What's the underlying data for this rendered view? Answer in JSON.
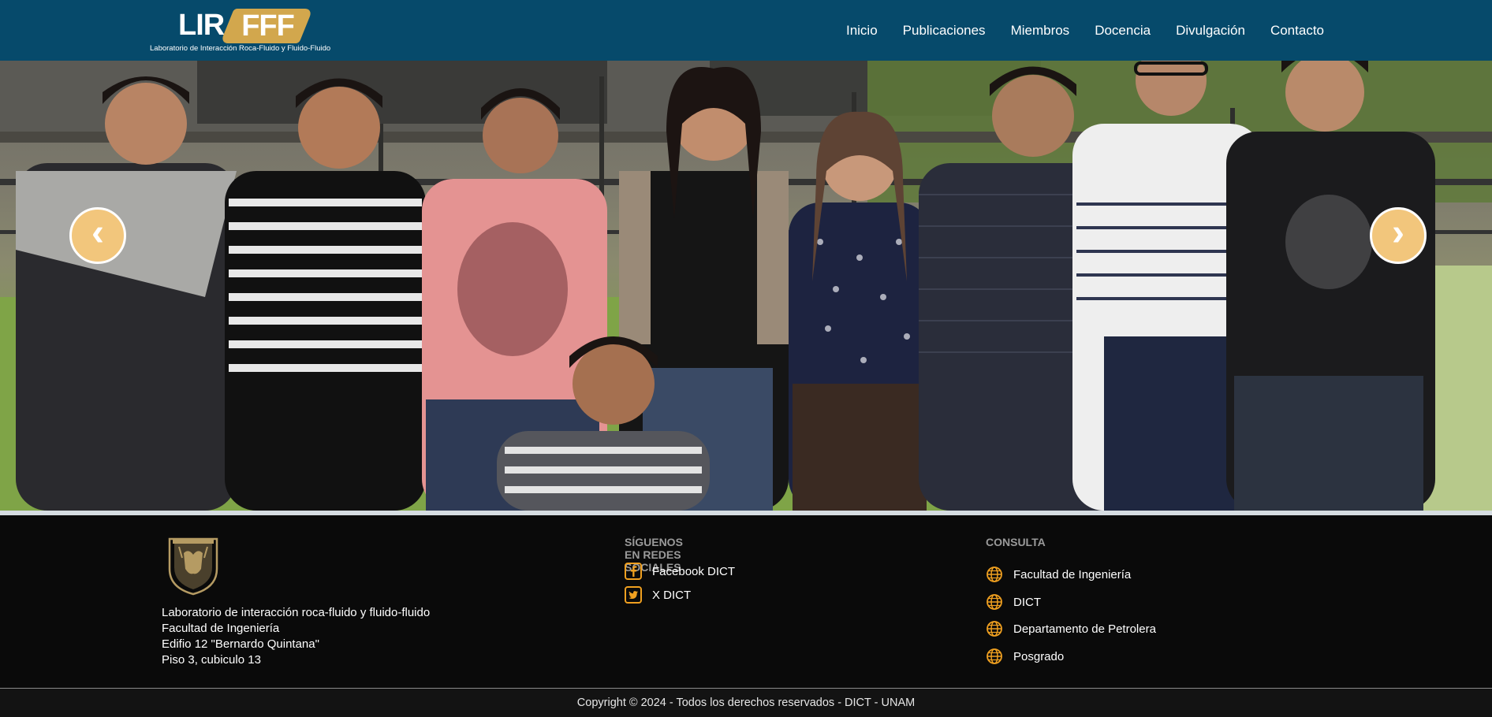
{
  "header": {
    "logo": {
      "part1": "LIR",
      "part2": "FFF",
      "subtitle": "Laboratorio de Interacción Roca-Fluido y Fluido-Fluido"
    },
    "nav": [
      {
        "label": "Inicio"
      },
      {
        "label": "Publicaciones"
      },
      {
        "label": "Miembros"
      },
      {
        "label": "Docencia"
      },
      {
        "label": "Divulgación"
      },
      {
        "label": "Contacto"
      }
    ],
    "bg_color": "#064a6b"
  },
  "hero": {
    "prev_glyph": "‹",
    "next_glyph": "›",
    "arrow_color": "#f2c67c"
  },
  "footer": {
    "address": [
      "Laboratorio de interacción roca-fluido y fluido-fluido",
      "Facultad de Ingeniería",
      "Edifio 12 \"Bernardo Quintana\"",
      "Piso 3, cubiculo 13"
    ],
    "social": {
      "title": "SÍGUENOS EN REDES SOCIALES",
      "links": [
        {
          "label": "Facebook DICT",
          "icon": "facebook-icon"
        },
        {
          "label": "X DICT",
          "icon": "twitter-icon"
        }
      ]
    },
    "consulta": {
      "title": "CONSULTA",
      "links": [
        {
          "label": "Facultad de Ingeniería",
          "icon": "globe-icon"
        },
        {
          "label": "DICT",
          "icon": "globe-icon"
        },
        {
          "label": "Departamento de Petrolera",
          "icon": "globe-icon"
        },
        {
          "label": "Posgrado",
          "icon": "globe-icon"
        }
      ]
    },
    "copyright": "Copyright © 2024 - Todos los derechos reservados - DICT - UNAM",
    "accent_color": "#f0a020"
  }
}
